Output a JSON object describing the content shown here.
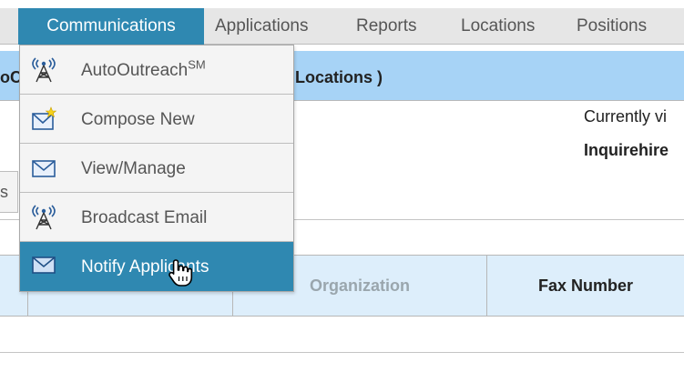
{
  "nav": {
    "items": [
      "Communications",
      "Applications",
      "Reports",
      "Locations",
      "Positions"
    ]
  },
  "blue_bar": {
    "left_text": "oC",
    "right_text": "Locations )"
  },
  "info": {
    "currently_viewing": "Currently vi",
    "site_name": "Inquirehire"
  },
  "tab_stub": "s",
  "table": {
    "headers": [
      "",
      "Organization",
      "Fax Number"
    ]
  },
  "dropdown": {
    "items": [
      {
        "label": "AutoOutreach",
        "sup": "SM",
        "icon": "antenna-icon"
      },
      {
        "label": "Compose New",
        "sup": "",
        "icon": "compose-envelope-icon"
      },
      {
        "label": "View/Manage",
        "sup": "",
        "icon": "envelope-icon"
      },
      {
        "label": "Broadcast Email",
        "sup": "",
        "icon": "antenna-icon"
      },
      {
        "label": "Notify Applicants",
        "sup": "",
        "icon": "envelope-icon"
      }
    ],
    "highlighted_index": 4
  },
  "colors": {
    "nav_active": "#2f88b1",
    "blue_bar": "#a7d3f6",
    "table_header": "#ddeefb",
    "menu_bg": "#f4f4f4"
  }
}
